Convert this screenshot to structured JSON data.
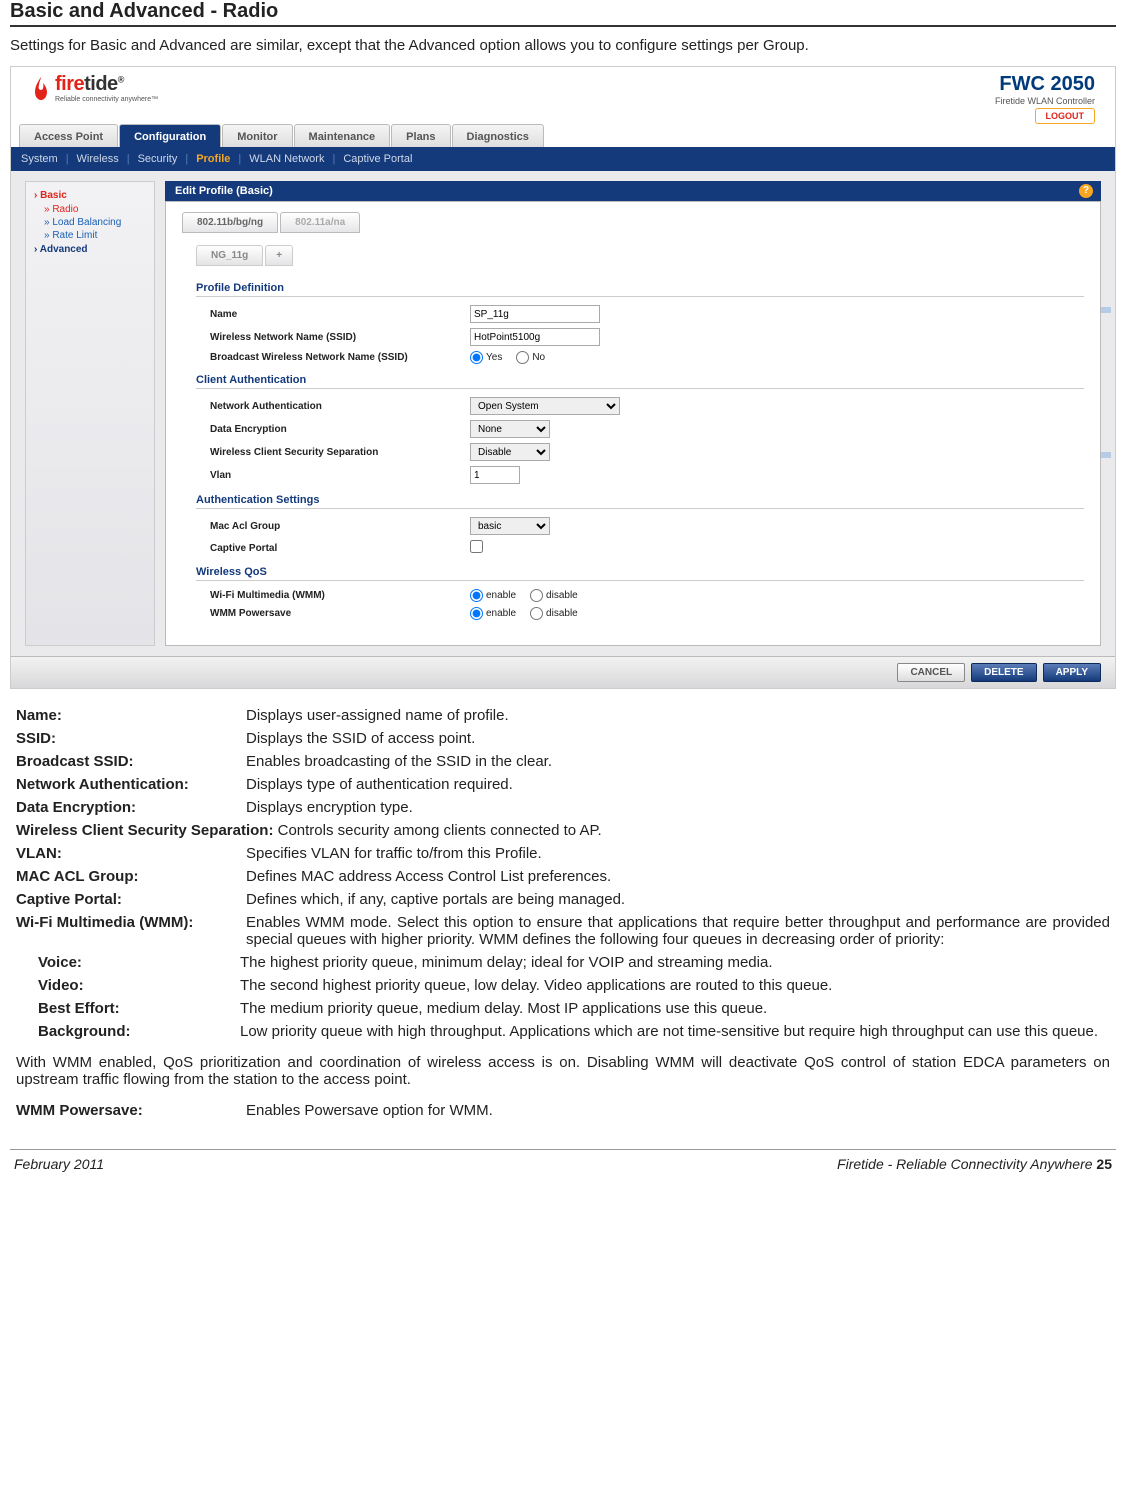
{
  "page": {
    "title": "Basic and Advanced - Radio",
    "intro": "Settings for Basic and Advanced are similar, except that the Advanced option allows you to configure settings per Group."
  },
  "branding": {
    "logo_fire": "fire",
    "logo_tide": "tide",
    "logo_tag": "Reliable connectivity anywhere™",
    "product": "FWC 2050",
    "product_sub": "Firetide WLAN Controller",
    "logout": "LOGOUT"
  },
  "top_tabs": [
    "Access Point",
    "Configuration",
    "Monitor",
    "Maintenance",
    "Plans",
    "Diagnostics"
  ],
  "top_tab_active": "Configuration",
  "sub_tabs": [
    "System",
    "Wireless",
    "Security",
    "Profile",
    "WLAN Network",
    "Captive Portal"
  ],
  "sub_tab_active": "Profile",
  "sidebar": {
    "basic": "Basic",
    "radio": "» Radio",
    "load": "» Load Balancing",
    "rate": "» Rate Limit",
    "advanced": "Advanced"
  },
  "panel": {
    "header": "Edit Profile (Basic)",
    "help": "?",
    "band_tabs": [
      "802.11b/bg/ng",
      "802.11a/na"
    ],
    "profile_tab": "NG_11g",
    "add_tab": "+",
    "sections": {
      "profile_def": "Profile Definition",
      "client_auth": "Client Authentication",
      "auth_settings": "Authentication Settings",
      "wireless_qos": "Wireless QoS"
    },
    "labels": {
      "name": "Name",
      "ssid": "Wireless Network Name (SSID)",
      "broadcast": "Broadcast Wireless Network Name (SSID)",
      "net_auth": "Network Authentication",
      "data_enc": "Data Encryption",
      "sec_sep": "Wireless Client Security Separation",
      "vlan": "Vlan",
      "mac_acl": "Mac Acl Group",
      "captive": "Captive Portal",
      "wmm": "Wi-Fi Multimedia (WMM)",
      "wmm_ps": "WMM Powersave"
    },
    "values": {
      "name": "SP_11g",
      "ssid": "HotPoint5100g",
      "broadcast": "Yes",
      "net_auth": "Open System",
      "data_enc": "None",
      "sec_sep": "Disable",
      "vlan": "1",
      "mac_acl": "basic",
      "wmm": "enable",
      "wmm_ps": "enable"
    },
    "opts": {
      "yes": "Yes",
      "no": "No",
      "enable": "enable",
      "disable": "disable"
    },
    "buttons": {
      "cancel": "CANCEL",
      "delete": "DELETE",
      "apply": "APPLY"
    }
  },
  "definitions": [
    {
      "label": "Name:",
      "text": "Displays user-assigned name of profile."
    },
    {
      "label": "SSID:",
      "text": "Displays the SSID of access point."
    },
    {
      "label": "Broadcast SSID:",
      "text": "Enables broadcasting of the SSID in the clear."
    },
    {
      "label": "Network Authentication:",
      "text": "Displays type of authentication required."
    },
    {
      "label": "Data Encryption:",
      "text": "Displays encryption type."
    }
  ],
  "def_full": {
    "label": "Wireless Client Security Separation:",
    "text": "Controls security among clients connected to AP."
  },
  "definitions2": [
    {
      "label": "VLAN:",
      "text": "Specifies VLAN for traffic to/from this Profile."
    },
    {
      "label": "MAC ACL Group:",
      "text": "Defines MAC address Access Control List preferences."
    },
    {
      "label": "Captive Portal:",
      "text": "Defines which, if any, captive portals are being managed."
    },
    {
      "label": "Wi-Fi Multimedia (WMM):",
      "text": "Enables WMM mode. Select this option to ensure that applications that require better throughput and performance are provided special queues with higher priority. WMM defines the following four queues in decreasing order of priority:"
    }
  ],
  "sub_definitions": [
    {
      "label": "Voice:",
      "text": " The highest priority queue, minimum delay; ideal for VOIP and streaming media."
    },
    {
      "label": "Video:",
      "text": "The second highest priority queue, low delay. Video applications are routed to this queue."
    },
    {
      "label": "Best Effort:",
      "text": "The medium priority queue, medium delay. Most IP applications use this queue."
    },
    {
      "label": "Background:",
      "text": "Low priority queue with high throughput. Applications which are not time-sensitive but require high throughput can use this queue."
    }
  ],
  "paragraph": "With WMM enabled, QoS prioritization and coordination of wireless access is on. Disabling WMM will deactivate QoS control of station EDCA parameters on upstream traffic flowing from the station to the access point.",
  "def_last": {
    "label": "WMM Powersave:",
    "text": "Enables Powersave option for WMM."
  },
  "footer": {
    "left": "February 2011",
    "right_text": "Firetide - Reliable Connectivity Anywhere ",
    "right_page": "25"
  }
}
